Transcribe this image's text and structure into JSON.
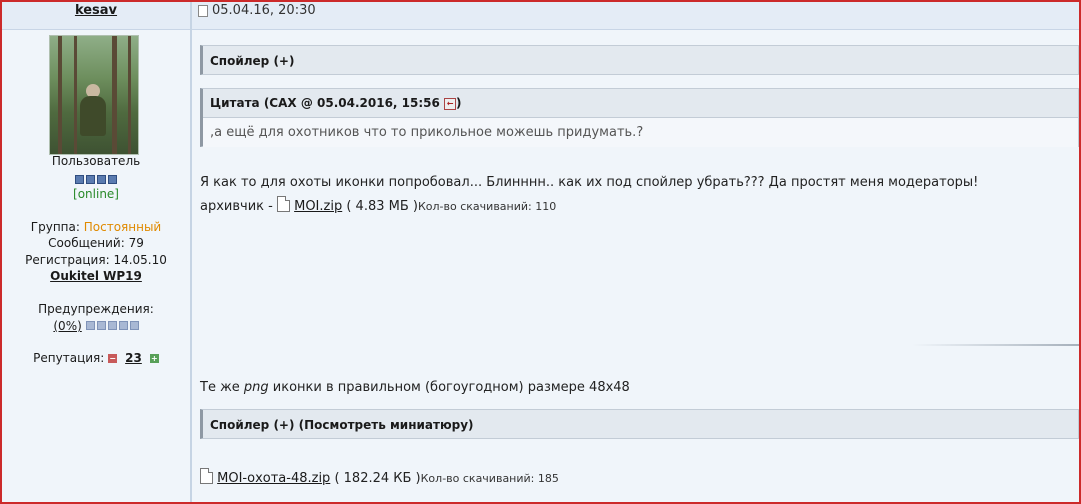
{
  "user": {
    "name": "kesav",
    "role": "Пользователь",
    "status": "[online]",
    "group_label": "Группа:",
    "group_value": "Постоянный",
    "posts_label": "Сообщений:",
    "posts_value": "79",
    "reg_label": "Регистрация:",
    "reg_value": "14.05.10",
    "device": "Oukitel WP19",
    "warnings_label": "Предупреждения:",
    "warnings_value": "(0%)",
    "rep_label": "Репутация:",
    "rep_value": "23",
    "rep_minus": "−",
    "rep_plus": "+"
  },
  "post": {
    "date": "05.04.16, 20:30",
    "spoiler1": "Спойлер (+)",
    "quote_header": "Цитата (САХ @ 05.04.2016, 15:56 ",
    "quote_header_end": ")",
    "quote_icon": "←",
    "quote_text": ",а ещё для охотников что то прикольное можешь придумать.?",
    "line1": "Я как то для охоты иконки попробовал... Блинннн.. как их под спойлер убрать??? Да простят меня модераторы!",
    "archive_label": "архивчик - ",
    "file1_name": "MOI.zip",
    "file1_size": " ( 4.83 МБ )",
    "file1_dl": "Кол-во скачиваний: 110",
    "line2_a": "Те же ",
    "line2_em": "png",
    "line2_b": " иконки в правильном (богоугодном) размере 48х48",
    "spoiler2": "Спойлер (+) (Посмотреть миниатюру)",
    "file2_name": "MOI-охота-48.zip",
    "file2_size": " ( 182.24 КБ )",
    "file2_dl": "Кол-во скачиваний: 185"
  }
}
